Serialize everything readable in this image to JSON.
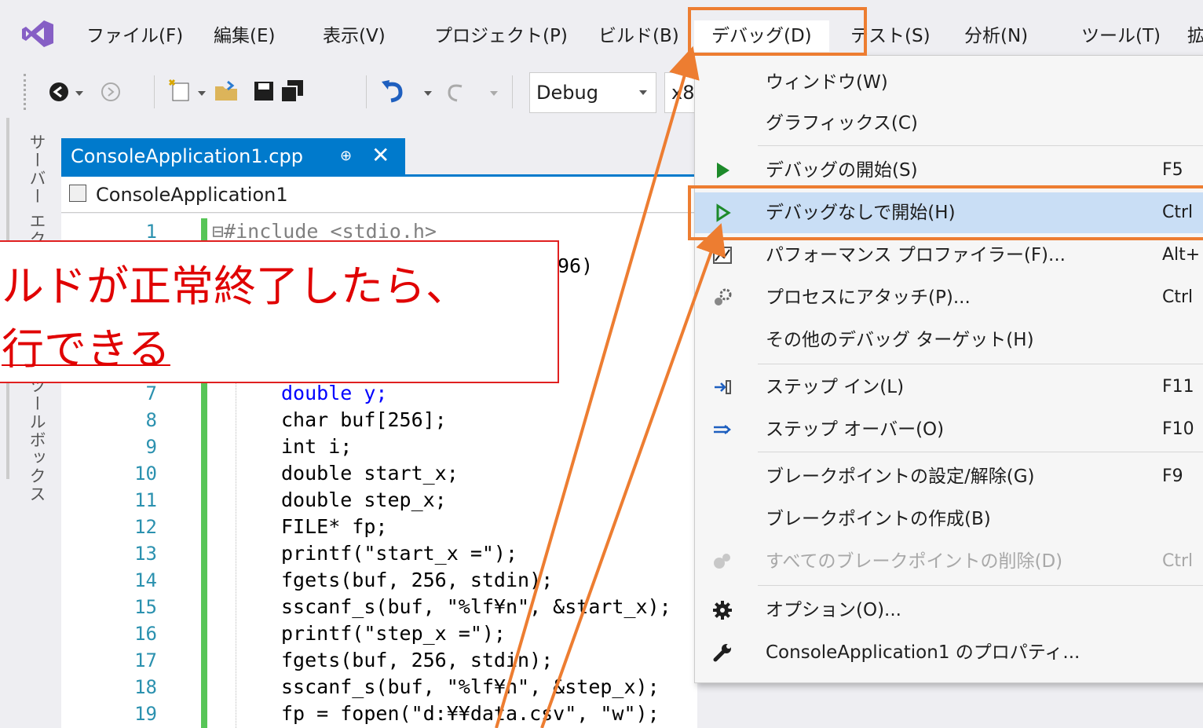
{
  "menubar": {
    "items": [
      "ファイル(F)",
      "編集(E)",
      "表示(V)",
      "プロジェクト(P)",
      "ビルド(B)",
      "デバッグ(D)",
      "テスト(S)",
      "分析(N)",
      "ツール(T)",
      "拡"
    ]
  },
  "toolbar": {
    "config_value": "Debug",
    "platform_value": "x8"
  },
  "sidebar": {
    "server_explorer": "サーバー エクスプローラー",
    "toolbox": "ツールボックス"
  },
  "editor": {
    "tab_title": "ConsoleApplication1.cpp",
    "pin_glyph": "⊕",
    "close_glyph": "✕",
    "nav_scope": "ConsoleApplication1",
    "lines": [
      {
        "no": "1",
        "text": "⊟#include <stdio.h>"
      },
      {
        "no": "",
        "text": "96)"
      },
      {
        "no": "7",
        "text": "double y;"
      },
      {
        "no": "8",
        "text": "char buf[256];"
      },
      {
        "no": "9",
        "text": "int i;"
      },
      {
        "no": "10",
        "text": "double start_x;"
      },
      {
        "no": "11",
        "text": "double step_x;"
      },
      {
        "no": "12",
        "text": "FILE* fp;"
      },
      {
        "no": "13",
        "text": "printf(\"start_x =\");"
      },
      {
        "no": "14",
        "text": "fgets(buf, 256, stdin);"
      },
      {
        "no": "15",
        "text": "sscanf_s(buf, \"%lf¥n\", &start_x);"
      },
      {
        "no": "16",
        "text": "printf(\"step_x =\");"
      },
      {
        "no": "17",
        "text": "fgets(buf, 256, stdin);"
      },
      {
        "no": "18",
        "text": "sscanf_s(buf, \"%lf¥n\", &step_x);"
      },
      {
        "no": "19",
        "text": "fp = fopen(\"d:¥¥data.csv\", \"w\");"
      }
    ]
  },
  "debug_menu": {
    "items": [
      {
        "label": "ウィンドウ(W)",
        "key": ""
      },
      {
        "label": "グラフィックス(C)",
        "key": ""
      },
      {
        "label": "デバッグの開始(S)",
        "key": "F5"
      },
      {
        "label": "デバッグなしで開始(H)",
        "key": "Ctrl"
      },
      {
        "label": "パフォーマンス プロファイラー(F)...",
        "key": "Alt+"
      },
      {
        "label": "プロセスにアタッチ(P)...",
        "key": "Ctrl"
      },
      {
        "label": "その他のデバッグ ターゲット(H)",
        "key": ""
      },
      {
        "label": "ステップ イン(L)",
        "key": "F11"
      },
      {
        "label": "ステップ オーバー(O)",
        "key": "F10"
      },
      {
        "label": "ブレークポイントの設定/解除(G)",
        "key": "F9"
      },
      {
        "label": "ブレークポイントの作成(B)",
        "key": ""
      },
      {
        "label": "すべてのブレークポイントの削除(D)",
        "key": "Ctrl"
      },
      {
        "label": "オプション(O)...",
        "key": ""
      },
      {
        "label": "ConsoleApplication1 のプロパティ...",
        "key": ""
      }
    ]
  },
  "callout": {
    "line1": "ルドが正常終了したら、",
    "line2": "行できる"
  },
  "colors": {
    "accent_orange": "#ed7d31",
    "vs_blue": "#007acc",
    "callout_red": "#e00000"
  }
}
